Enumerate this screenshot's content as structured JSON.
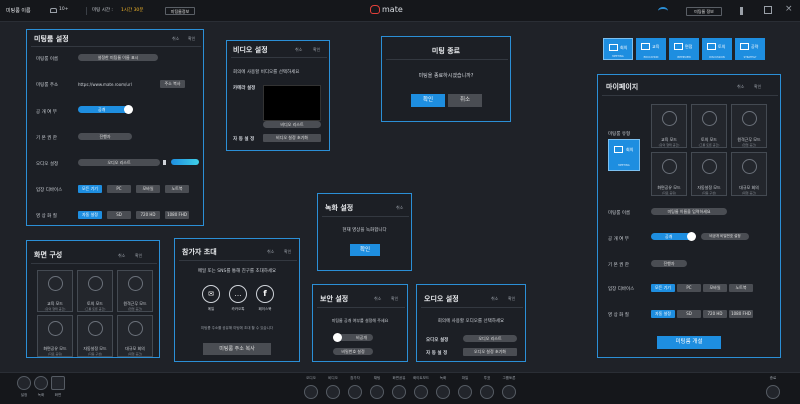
{
  "top": {
    "meeting_name": "미팅룸 이름",
    "participants": "10+",
    "time_label": "미팅 시간 :",
    "time_value": "1시간 30분",
    "room_info_btn": "미팅룸정보",
    "logo": "mate",
    "info_btn": "미팅룸 정보"
  },
  "meeting_settings": {
    "title": "미팅룸 설정",
    "cancel": "취소",
    "confirm": "확인",
    "name_label": "미팅룸 이름",
    "name_value": "설정한 미팅룸 이름 표시",
    "addr_label": "미팅룸 주소",
    "addr_value": "https://www.mate.room/url",
    "addr_copy": "주소 복사",
    "public_label": "공 개 여 부",
    "public_value": "공개",
    "perm_label": "기 본 권 한",
    "perm_value": "진행자",
    "audio_label": "오디오 설정",
    "audio_value": "오디오 리스트",
    "device_label": "입장 디바이스",
    "devices": [
      "모든 기기",
      "PC",
      "모바일",
      "노트북"
    ],
    "quality_label": "영 상 화 질",
    "qualities": [
      "자동 설정",
      "SD",
      "720 HD",
      "1080 FHD"
    ]
  },
  "video_settings": {
    "title": "비디오 설정",
    "cancel": "취소",
    "confirm": "확인",
    "desc": "회의에 사용할 비디오를 선택하세요",
    "camera_label": "카메라 설정",
    "camera_value": "비디오 리스트",
    "auto_label": "자 동 설 정",
    "auto_btn": "비디오 설정 초기화"
  },
  "meeting_end": {
    "title": "미팅 종료",
    "question": "미팅을 종료하시겠습니까?",
    "ok": "확인",
    "cancel": "취소"
  },
  "mode_tabs": [
    {
      "label": "회의",
      "sub": "MEETING"
    },
    {
      "label": "교육",
      "sub": "EDUCATION"
    },
    {
      "label": "면접",
      "sub": "INTERVIEW"
    },
    {
      "label": "토의",
      "sub": "DISCUSSION"
    },
    {
      "label": "공략",
      "sub": "STRATEGY"
    }
  ],
  "mypage": {
    "title": "마이페이지",
    "cancel": "취소",
    "confirm": "확인",
    "type_label": "미팅룸 유형",
    "selected_tile": {
      "label": "회의",
      "sub": "MEETING"
    },
    "tiles": [
      {
        "cap": "교육 모드",
        "sub": "(강의 형태 공간)"
      },
      {
        "cap": "토의 모드",
        "sub": "(그룹 토론 공간)"
      },
      {
        "cap": "원격근무 모드",
        "sub": "(협업 공간)"
      },
      {
        "cap": "화면공유 모드",
        "sub": "(자료 공유)"
      },
      {
        "cap": "자동설정 모드",
        "sub": "(자동 구성)"
      },
      {
        "cap": "대규모 회의",
        "sub": "(대형 공간)"
      }
    ],
    "name_label": "미팅룸 이름",
    "name_value": "미팅룸 이름을 입력하세요",
    "public_label": "공 개 여 부",
    "public_value": "공개",
    "private_btn": "비공개 비밀번호 설정",
    "perm_label": "기 본 권 한",
    "perm_value": "진행자",
    "device_label": "입장 디바이스",
    "devices": [
      "모든 기기",
      "PC",
      "모바일",
      "노트북"
    ],
    "quality_label": "영 상 화 질",
    "qualities": [
      "자동 설정",
      "SD",
      "720 HD",
      "1080 FHD"
    ],
    "open_btn": "미팅룸 개설"
  },
  "screen_layout": {
    "title": "화면 구성",
    "cancel": "취소",
    "confirm": "확인",
    "tiles": [
      {
        "cap": "교육 모드",
        "sub": "(강의 형태 공간)"
      },
      {
        "cap": "토의 모드",
        "sub": "(그룹 토론 공간)"
      },
      {
        "cap": "원격근무 모드",
        "sub": "(협업 공간)"
      },
      {
        "cap": "화면공유 모드",
        "sub": "(자료 공유)"
      },
      {
        "cap": "자동설정 모드",
        "sub": "(자동 구성)"
      },
      {
        "cap": "대규모 회의",
        "sub": "(대형 공간)"
      }
    ]
  },
  "invite": {
    "title": "참가자 초대",
    "cancel": "취소",
    "confirm": "확인",
    "desc": "메일 또는 SNS를 통해 친구를 초대하세요",
    "channels": [
      "메일",
      "카카오톡",
      "페이스북"
    ],
    "note": "미팅룸 주소를 공유해 미팅에 초대 할 수 있습니다",
    "copy_btn": "미팅룸 주소 복사"
  },
  "record": {
    "title": "녹화 설정",
    "cancel": "취소",
    "desc": "현재 영상을 녹화합니다",
    "ok": "확인"
  },
  "security": {
    "title": "보안 설정",
    "cancel": "취소",
    "confirm": "확인",
    "desc": "미팅룸 공개 여부를 설정해 주세요",
    "toggle": "비공개",
    "pw_btn": "비밀번호 설정"
  },
  "audio_settings": {
    "title": "오디오 설정",
    "cancel": "취소",
    "confirm": "확인",
    "desc": "회의에 사용할 오디오를 선택하세요",
    "audio_label": "오디오 설정",
    "audio_value": "오디오 리스트",
    "auto_label": "자 동 설 정",
    "auto_btn": "오디오 설정 초기화"
  },
  "bottom": {
    "left": [
      "설정",
      "녹화",
      "화면"
    ],
    "center": [
      "오디오",
      "비디오",
      "참가자",
      "채팅",
      "화면공유",
      "화이트보드",
      "녹화",
      "파일",
      "투표",
      "그룹토론"
    ],
    "right": "종료"
  }
}
